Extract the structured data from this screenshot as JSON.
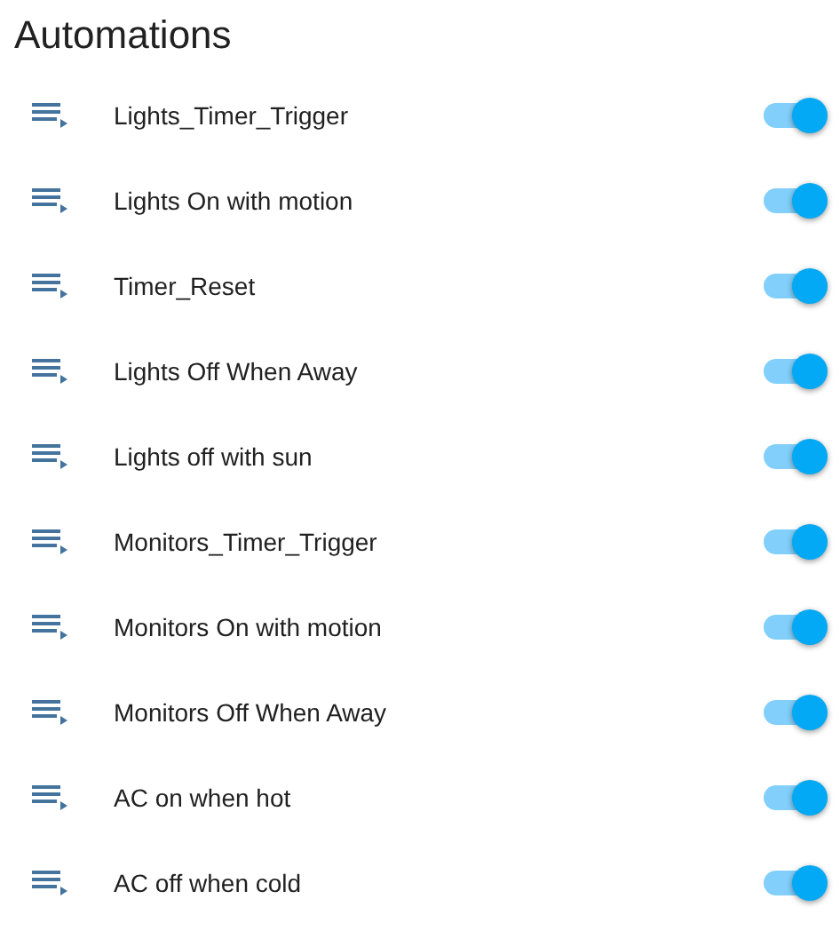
{
  "title": "Automations",
  "automations": [
    {
      "name": "Lights_Timer_Trigger",
      "on": true
    },
    {
      "name": "Lights On with motion",
      "on": true
    },
    {
      "name": "Timer_Reset",
      "on": true
    },
    {
      "name": "Lights Off When Away",
      "on": true
    },
    {
      "name": "Lights off with sun",
      "on": true
    },
    {
      "name": "Monitors_Timer_Trigger",
      "on": true
    },
    {
      "name": "Monitors On with motion",
      "on": true
    },
    {
      "name": "Monitors Off When Away",
      "on": true
    },
    {
      "name": "AC on when hot",
      "on": true
    },
    {
      "name": "AC off when cold",
      "on": true
    }
  ]
}
